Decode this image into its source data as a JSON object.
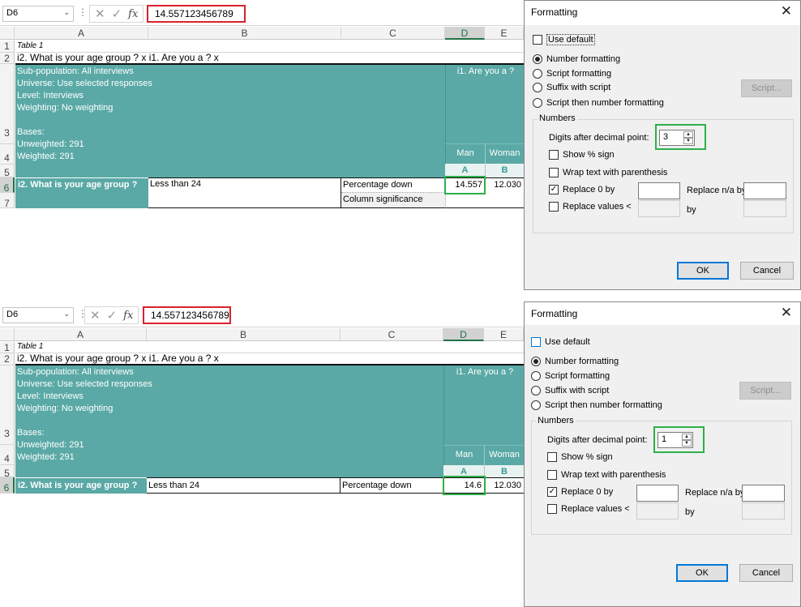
{
  "panels": [
    {
      "excel": {
        "name_box": "D6",
        "formula_value": "14.557123456789",
        "columns": [
          "A",
          "B",
          "C",
          "D",
          "E"
        ],
        "rows": [
          "1",
          "2",
          "3",
          "4",
          "5",
          "6",
          "7"
        ],
        "table_title": "Table 1",
        "question": "i2. What is your age group ? x i1. Are you a ? x",
        "info_lines": [
          "Sub-population: All interviews",
          "Universe: Use selected responses",
          "Level: Interviews",
          "Weighting: No weighting",
          "",
          "Bases:",
          "Unweighted: 291",
          "Weighted: 291"
        ],
        "banner": "i1. Are you a ?",
        "col_man": "Man",
        "col_woman": "Woman",
        "letter_a": "A",
        "letter_b": "B",
        "row_label": "i2. What is your age group ?",
        "category": "Less than 24",
        "stat1": "Percentage down",
        "stat2": "Column significance",
        "value_d6": "14.557",
        "value_e6": "12.030"
      },
      "dialog": {
        "title": "Formatting",
        "close": "✕",
        "use_default": "Use default",
        "radios": [
          "Number formatting",
          "Script formatting",
          "Suffix with script",
          "Script then number formatting"
        ],
        "script_button": "Script...",
        "numbers_group": "Numbers",
        "digits_label": "Digits after decimal point:",
        "digits_value": "3",
        "show_percent": "Show % sign",
        "wrap_text": "Wrap text with parenthesis",
        "replace_zero": "Replace 0 by",
        "replace_na": "Replace n/a by",
        "replace_values": "Replace values <",
        "by_label": "by",
        "ok": "OK",
        "cancel": "Cancel"
      }
    },
    {
      "excel": {
        "name_box": "D6",
        "formula_value": "14.557123456789",
        "columns": [
          "A",
          "B",
          "C",
          "D",
          "E"
        ],
        "rows": [
          "1",
          "2",
          "3",
          "4",
          "5",
          "6"
        ],
        "table_title": "Table 1",
        "question": "i2. What is your age group ? x i1. Are you a ? x",
        "info_lines": [
          "Sub-population: All interviews",
          "Universe: Use selected responses",
          "Level: Interviews",
          "Weighting: No weighting",
          "",
          "Bases:",
          "Unweighted: 291",
          "Weighted: 291"
        ],
        "banner": "i1. Are you a ?",
        "col_man": "Man",
        "col_woman": "Woman",
        "letter_a": "A",
        "letter_b": "B",
        "row_label": "i2. What is your age group ?",
        "category": "Less than 24",
        "stat1": "Percentage down",
        "value_d6": "14.6",
        "value_e6": "12.030"
      },
      "dialog": {
        "title": "Formatting",
        "close": "✕",
        "use_default": "Use default",
        "radios": [
          "Number formatting",
          "Script formatting",
          "Suffix with script",
          "Script then number formatting"
        ],
        "script_button": "Script...",
        "numbers_group": "Numbers",
        "digits_label": "Digits after decimal point:",
        "digits_value": "1",
        "show_percent": "Show % sign",
        "wrap_text": "Wrap text with parenthesis",
        "replace_zero": "Replace 0 by",
        "replace_na": "Replace n/a by",
        "replace_values": "Replace values <",
        "by_label": "by",
        "ok": "OK",
        "cancel": "Cancel"
      }
    }
  ],
  "colors": {
    "teal": "#5aa9a6",
    "highlight_red": "#d9232d",
    "highlight_green": "#2db04b",
    "excel_green": "#217346",
    "default_button_blue": "#0078d7"
  },
  "icons": {
    "cancel_formula": "x-icon",
    "enter_formula": "check-icon",
    "function": "fx-icon",
    "dropdown": "chevron-down-icon",
    "close": "close-icon"
  }
}
